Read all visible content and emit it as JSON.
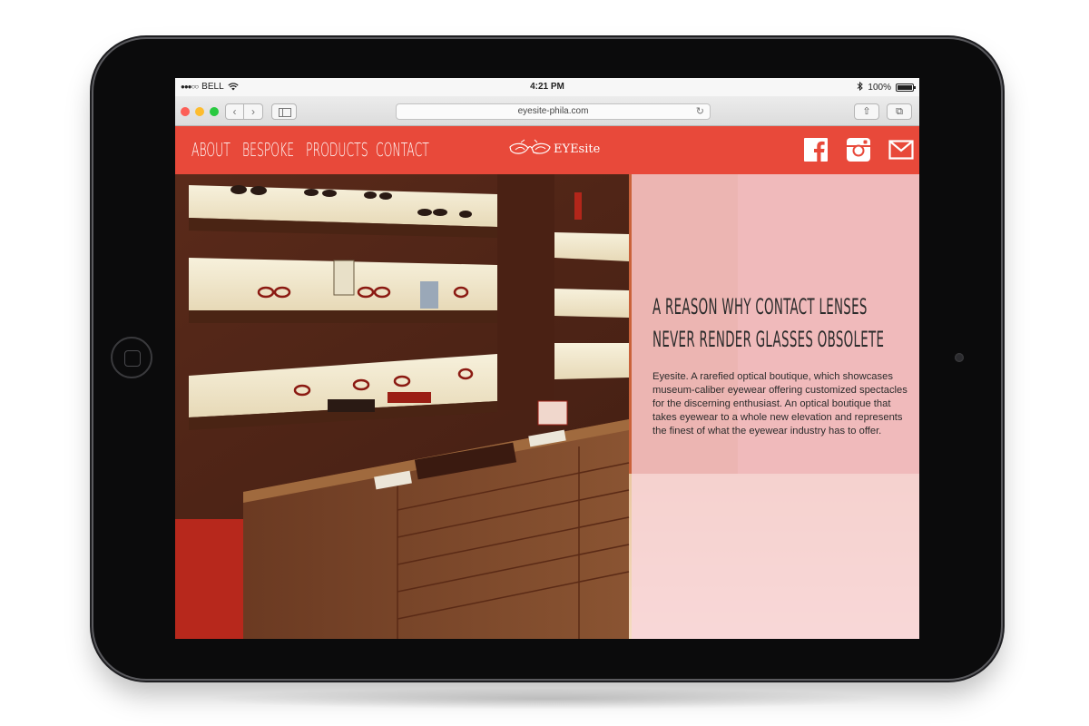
{
  "status_bar": {
    "carrier": "BELL",
    "time": "4:21 PM",
    "battery": "100%"
  },
  "browser": {
    "url": "eyesite-phila.com"
  },
  "site": {
    "nav": [
      "ABOUT",
      "BESPOKE",
      "PRODUCTS",
      "CONTACT"
    ],
    "logo_text": "EYEsite",
    "social": [
      "facebook-icon",
      "instagram-icon",
      "mail-icon"
    ],
    "brand_color": "#e8493a"
  },
  "hero": {
    "headline": "A REASON WHY CONTACT LENSES NEVER RENDER GLASSES OBSOLETE",
    "description": "Eyesite. A rarefied optical boutique, which showcases museum-caliber eyewear offering customized spectacles for the discerning enthusiast. An optical boutique that takes eyewear to a whole new elevation and represents the finest of what the eyewear industry has to offer."
  }
}
